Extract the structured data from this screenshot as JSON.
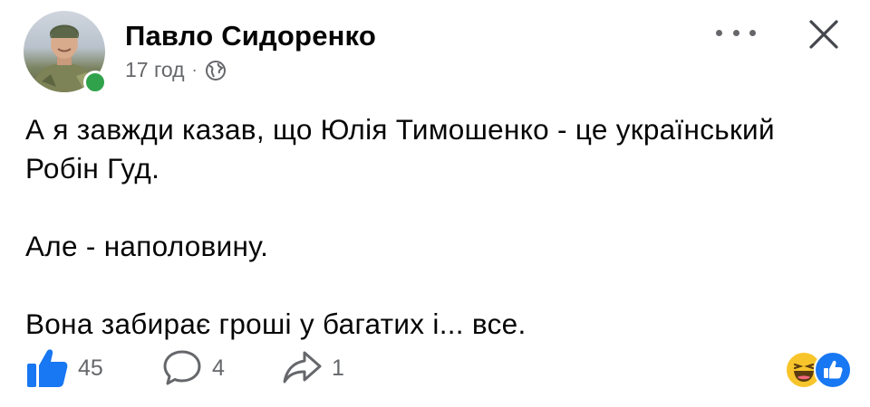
{
  "post": {
    "author": "Павло Сидоренко",
    "time": "17 год",
    "separator": "·",
    "privacy_icon": "globe-icon",
    "paragraphs": [
      "А я завжди казав, що Юлія Тимошенко - це український Робін Гуд.",
      "Але - наполовину.",
      "Вона забирає гроші у багатих і... все."
    ]
  },
  "actions": {
    "likes": "45",
    "comments": "4",
    "shares": "1"
  },
  "reactions": [
    "haha",
    "like"
  ],
  "colors": {
    "online": "#31a24c",
    "like_blue": "#1877f2",
    "muted": "#65676b"
  }
}
